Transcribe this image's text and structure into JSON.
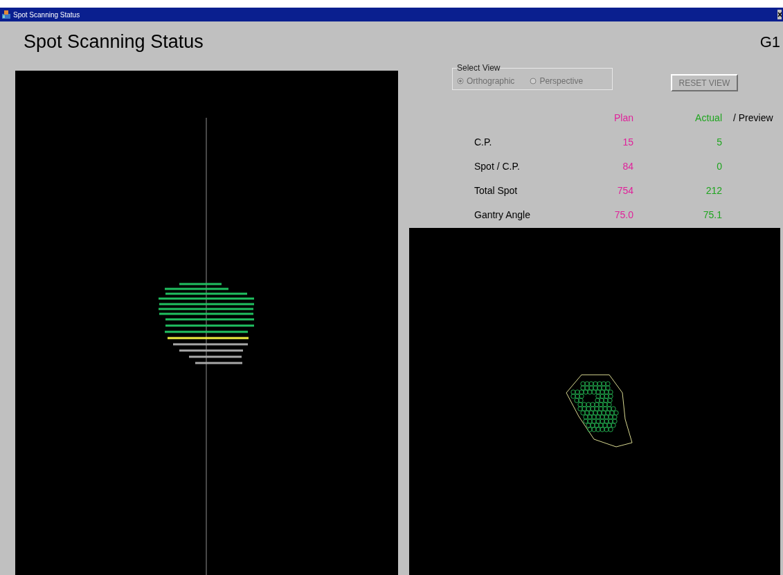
{
  "window": {
    "title": "Spot Scanning Status"
  },
  "heading": "Spot Scanning Status",
  "gantry": "G1",
  "select_view": {
    "legend": "Select View",
    "options": [
      {
        "label": "Orthographic",
        "selected": true,
        "disabled": true
      },
      {
        "label": "Perspective",
        "selected": false,
        "disabled": true
      }
    ]
  },
  "reset_button": {
    "label": "RESET VIEW",
    "disabled": true
  },
  "table": {
    "columns": [
      "Plan",
      "Actual",
      "/ Preview"
    ],
    "rows": [
      {
        "label": "C.P.",
        "plan": "15",
        "actual": "5"
      },
      {
        "label": "Spot / C.P.",
        "plan": "84",
        "actual": "0"
      },
      {
        "label": "Total Spot",
        "plan": "754",
        "actual": "212"
      },
      {
        "label": "Gantry Angle",
        "plan": "75.0",
        "actual": "75.1"
      }
    ]
  }
}
